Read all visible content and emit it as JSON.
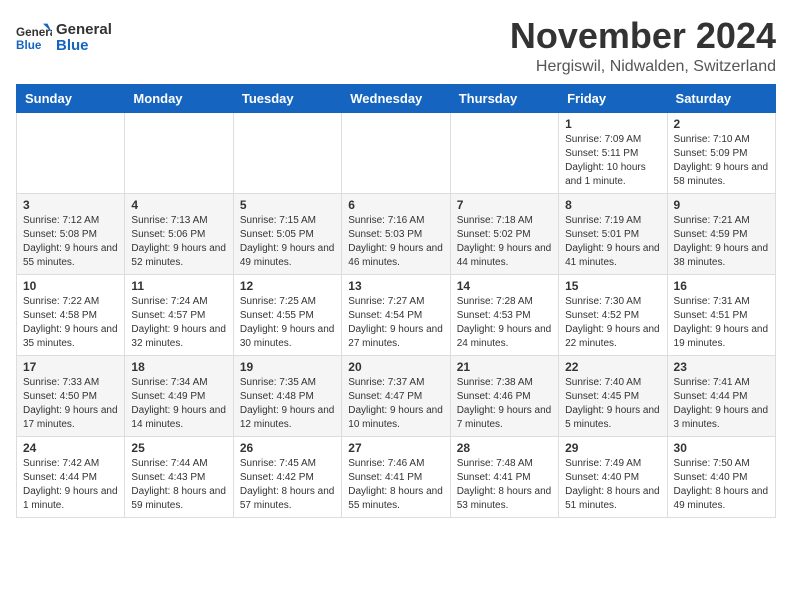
{
  "logo": {
    "text_general": "General",
    "text_blue": "Blue"
  },
  "header": {
    "month_year": "November 2024",
    "location": "Hergiswil, Nidwalden, Switzerland"
  },
  "weekdays": [
    "Sunday",
    "Monday",
    "Tuesday",
    "Wednesday",
    "Thursday",
    "Friday",
    "Saturday"
  ],
  "weeks": [
    [
      {
        "day": "",
        "info": ""
      },
      {
        "day": "",
        "info": ""
      },
      {
        "day": "",
        "info": ""
      },
      {
        "day": "",
        "info": ""
      },
      {
        "day": "",
        "info": ""
      },
      {
        "day": "1",
        "info": "Sunrise: 7:09 AM\nSunset: 5:11 PM\nDaylight: 10 hours and 1 minute."
      },
      {
        "day": "2",
        "info": "Sunrise: 7:10 AM\nSunset: 5:09 PM\nDaylight: 9 hours and 58 minutes."
      }
    ],
    [
      {
        "day": "3",
        "info": "Sunrise: 7:12 AM\nSunset: 5:08 PM\nDaylight: 9 hours and 55 minutes."
      },
      {
        "day": "4",
        "info": "Sunrise: 7:13 AM\nSunset: 5:06 PM\nDaylight: 9 hours and 52 minutes."
      },
      {
        "day": "5",
        "info": "Sunrise: 7:15 AM\nSunset: 5:05 PM\nDaylight: 9 hours and 49 minutes."
      },
      {
        "day": "6",
        "info": "Sunrise: 7:16 AM\nSunset: 5:03 PM\nDaylight: 9 hours and 46 minutes."
      },
      {
        "day": "7",
        "info": "Sunrise: 7:18 AM\nSunset: 5:02 PM\nDaylight: 9 hours and 44 minutes."
      },
      {
        "day": "8",
        "info": "Sunrise: 7:19 AM\nSunset: 5:01 PM\nDaylight: 9 hours and 41 minutes."
      },
      {
        "day": "9",
        "info": "Sunrise: 7:21 AM\nSunset: 4:59 PM\nDaylight: 9 hours and 38 minutes."
      }
    ],
    [
      {
        "day": "10",
        "info": "Sunrise: 7:22 AM\nSunset: 4:58 PM\nDaylight: 9 hours and 35 minutes."
      },
      {
        "day": "11",
        "info": "Sunrise: 7:24 AM\nSunset: 4:57 PM\nDaylight: 9 hours and 32 minutes."
      },
      {
        "day": "12",
        "info": "Sunrise: 7:25 AM\nSunset: 4:55 PM\nDaylight: 9 hours and 30 minutes."
      },
      {
        "day": "13",
        "info": "Sunrise: 7:27 AM\nSunset: 4:54 PM\nDaylight: 9 hours and 27 minutes."
      },
      {
        "day": "14",
        "info": "Sunrise: 7:28 AM\nSunset: 4:53 PM\nDaylight: 9 hours and 24 minutes."
      },
      {
        "day": "15",
        "info": "Sunrise: 7:30 AM\nSunset: 4:52 PM\nDaylight: 9 hours and 22 minutes."
      },
      {
        "day": "16",
        "info": "Sunrise: 7:31 AM\nSunset: 4:51 PM\nDaylight: 9 hours and 19 minutes."
      }
    ],
    [
      {
        "day": "17",
        "info": "Sunrise: 7:33 AM\nSunset: 4:50 PM\nDaylight: 9 hours and 17 minutes."
      },
      {
        "day": "18",
        "info": "Sunrise: 7:34 AM\nSunset: 4:49 PM\nDaylight: 9 hours and 14 minutes."
      },
      {
        "day": "19",
        "info": "Sunrise: 7:35 AM\nSunset: 4:48 PM\nDaylight: 9 hours and 12 minutes."
      },
      {
        "day": "20",
        "info": "Sunrise: 7:37 AM\nSunset: 4:47 PM\nDaylight: 9 hours and 10 minutes."
      },
      {
        "day": "21",
        "info": "Sunrise: 7:38 AM\nSunset: 4:46 PM\nDaylight: 9 hours and 7 minutes."
      },
      {
        "day": "22",
        "info": "Sunrise: 7:40 AM\nSunset: 4:45 PM\nDaylight: 9 hours and 5 minutes."
      },
      {
        "day": "23",
        "info": "Sunrise: 7:41 AM\nSunset: 4:44 PM\nDaylight: 9 hours and 3 minutes."
      }
    ],
    [
      {
        "day": "24",
        "info": "Sunrise: 7:42 AM\nSunset: 4:44 PM\nDaylight: 9 hours and 1 minute."
      },
      {
        "day": "25",
        "info": "Sunrise: 7:44 AM\nSunset: 4:43 PM\nDaylight: 8 hours and 59 minutes."
      },
      {
        "day": "26",
        "info": "Sunrise: 7:45 AM\nSunset: 4:42 PM\nDaylight: 8 hours and 57 minutes."
      },
      {
        "day": "27",
        "info": "Sunrise: 7:46 AM\nSunset: 4:41 PM\nDaylight: 8 hours and 55 minutes."
      },
      {
        "day": "28",
        "info": "Sunrise: 7:48 AM\nSunset: 4:41 PM\nDaylight: 8 hours and 53 minutes."
      },
      {
        "day": "29",
        "info": "Sunrise: 7:49 AM\nSunset: 4:40 PM\nDaylight: 8 hours and 51 minutes."
      },
      {
        "day": "30",
        "info": "Sunrise: 7:50 AM\nSunset: 4:40 PM\nDaylight: 8 hours and 49 minutes."
      }
    ]
  ]
}
